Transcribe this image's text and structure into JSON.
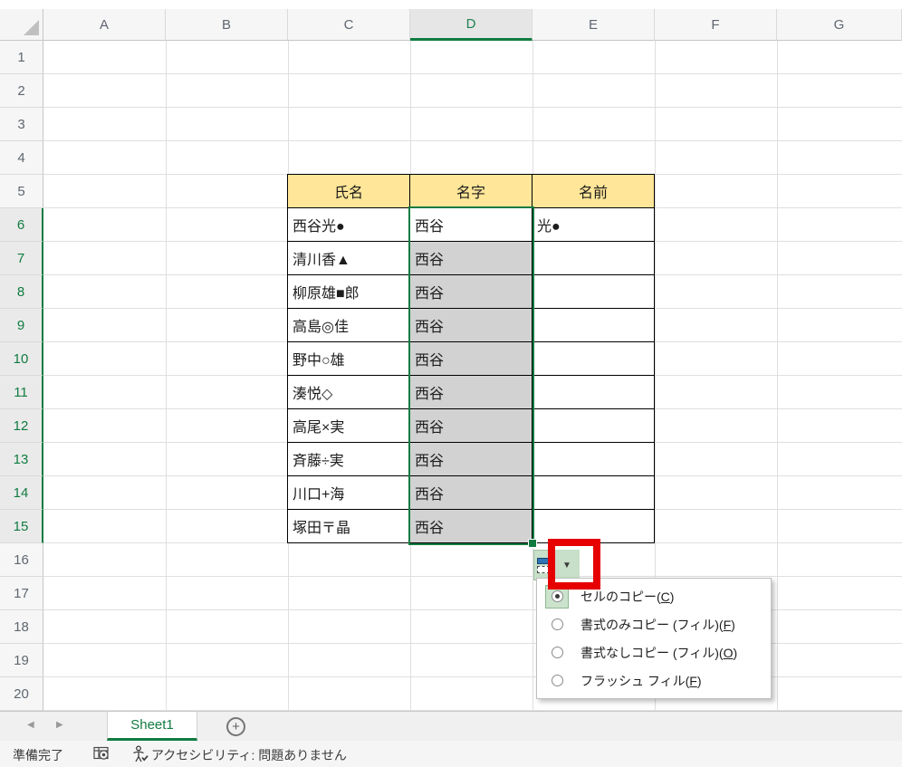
{
  "grid": {
    "columns": [
      "A",
      "B",
      "C",
      "D",
      "E",
      "F",
      "G"
    ],
    "rows": [
      "1",
      "2",
      "3",
      "4",
      "5",
      "6",
      "7",
      "8",
      "9",
      "10",
      "11",
      "12",
      "13",
      "14",
      "15",
      "16",
      "17",
      "18",
      "19",
      "20"
    ],
    "selection": {
      "column": "D",
      "row_start": 6,
      "row_end": 15
    }
  },
  "table": {
    "headers": [
      "氏名",
      "名字",
      "名前"
    ],
    "rows": [
      [
        "西谷光●",
        "西谷",
        "光●"
      ],
      [
        "清川香▲",
        "西谷",
        ""
      ],
      [
        "柳原雄■郎",
        "西谷",
        ""
      ],
      [
        "高島◎佳",
        "西谷",
        ""
      ],
      [
        "野中○雄",
        "西谷",
        ""
      ],
      [
        "湊悦◇",
        "西谷",
        ""
      ],
      [
        "高尾×実",
        "西谷",
        ""
      ],
      [
        "斉藤÷実",
        "西谷",
        ""
      ],
      [
        "川口+海",
        "西谷",
        ""
      ],
      [
        "塚田〒晶",
        "西谷",
        ""
      ]
    ]
  },
  "autofill_menu": {
    "items": [
      {
        "pre": "セルのコピー(",
        "key": "C",
        "post": ")",
        "selected": true
      },
      {
        "pre": "書式のみコピー (フィル)(",
        "key": "F",
        "post": ")",
        "selected": false
      },
      {
        "pre": "書式なしコピー (フィル)(",
        "key": "O",
        "post": ")",
        "selected": false
      },
      {
        "pre": "フラッシュ フィル(",
        "key": "F",
        "post": ")",
        "selected": false
      }
    ]
  },
  "sheet_tabs": {
    "active_label": "Sheet1"
  },
  "status_bar": {
    "ready": "準備完了",
    "accessibility": "アクセシビリティ: 問題ありません"
  },
  "colors": {
    "excel_green": "#107C41",
    "table_header_fill": "#FFE699",
    "selected_range_fill": "#D2D2D2",
    "annotation_red": "#E60000"
  }
}
